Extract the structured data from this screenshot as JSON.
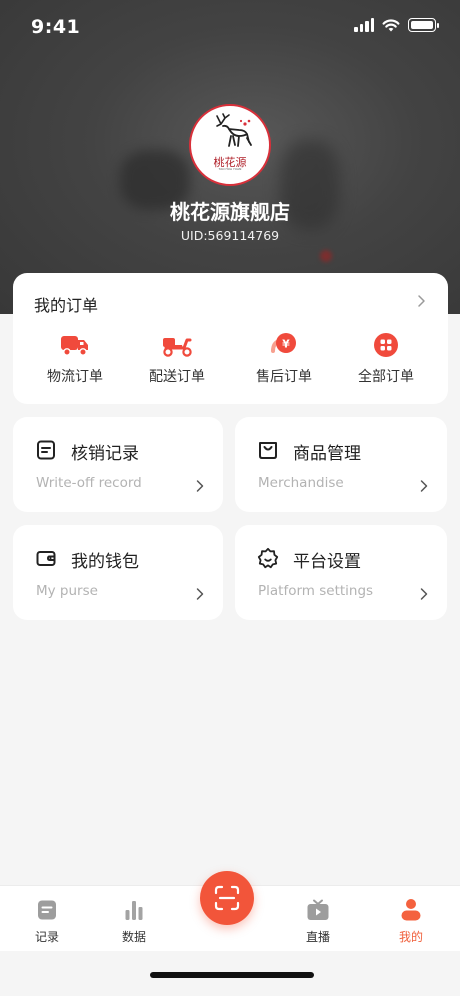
{
  "status_bar": {
    "time": "9:41"
  },
  "profile": {
    "avatar_logo_text": "桃花源",
    "avatar_logo_subtext": "TAO HUA YUAN",
    "shop_name": "桃花源旗舰店",
    "uid": "UID:569114769"
  },
  "orders": {
    "title": "我的订单",
    "items": [
      {
        "label": "物流订单",
        "icon": "truck-icon"
      },
      {
        "label": "配送订单",
        "icon": "scooter-icon"
      },
      {
        "label": "售后订单",
        "icon": "yuan-icon"
      },
      {
        "label": "全部订单",
        "icon": "grid-icon"
      }
    ]
  },
  "functions": [
    {
      "title": "核销记录",
      "subtitle": "Write-off record",
      "icon": "record-icon"
    },
    {
      "title": "商品管理",
      "subtitle": "Merchandise",
      "icon": "bag-icon"
    },
    {
      "title": "我的钱包",
      "subtitle": "My purse",
      "icon": "wallet-icon"
    },
    {
      "title": "平台设置",
      "subtitle": "Platform settings",
      "icon": "settings-icon"
    }
  ],
  "tabbar": {
    "items": [
      {
        "label": "记录",
        "icon": "record-tab-icon",
        "active": false
      },
      {
        "label": "数据",
        "icon": "bar-chart-icon",
        "active": false
      },
      {
        "label": "",
        "icon": "scan-icon",
        "active": false
      },
      {
        "label": "直播",
        "icon": "live-tv-icon",
        "active": false
      },
      {
        "label": "我的",
        "icon": "user-icon",
        "active": true
      }
    ]
  },
  "colors": {
    "accent": "#f2553a",
    "active_tab": "#f0603c",
    "header_bg": "#434343"
  }
}
